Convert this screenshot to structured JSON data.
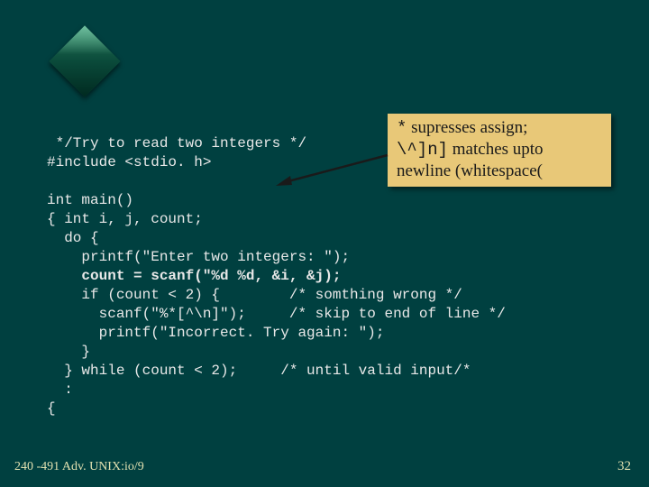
{
  "code": {
    "l1": " */Try to read two integers */",
    "l2": "#include <stdio. h>",
    "l3": "",
    "l4": "int main()",
    "l5": "{ int i, j, count;",
    "l6": "  do {",
    "l7": "    printf(\"Enter two integers: \");",
    "l8": "    count = scanf(\"%d %d, &i, &j);",
    "l9": "    if (count < 2) {        /* somthing wrong */",
    "l10": "      scanf(\"%*[^\\n]\");     /* skip to end of line */",
    "l11": "      printf(\"Incorrect. Try again: \");",
    "l12": "    }",
    "l13": "  } while (count < 2);     /* until valid input/*",
    "l14": "  :",
    "l15": "{"
  },
  "callout": {
    "star": " *",
    "line1_rest": " supresses assign;",
    "line2_mono": "\\^]n]",
    "line2_rest": " matches upto",
    "line3": "newline (whitespace("
  },
  "footer": {
    "left": "240 -491 Adv. UNIX:io/9",
    "right": "32"
  }
}
